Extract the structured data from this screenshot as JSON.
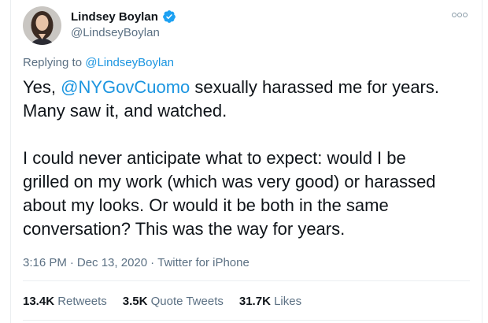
{
  "author": {
    "display_name": "Lindsey Boylan",
    "handle": "@LindseyBoylan",
    "verified_color": "#1da1f2"
  },
  "reply": {
    "prefix": "Replying to",
    "target": "@LindseyBoylan"
  },
  "tweet": {
    "line1_prefix": "Yes, ",
    "mention": "@NYGovCuomo",
    "line1_suffix": " sexually harassed me for years.",
    "line2": "Many saw it, and watched.",
    "paragraph2": "I could never anticipate what to expect: would I be\ngrilled on my work (which was very good) or harassed\nabout my looks. Or would it be both in the same\nconversation? This was the way for years."
  },
  "meta": {
    "time": "3:16 PM",
    "sep1": "·",
    "date": "Dec 13, 2020",
    "sep2": "·",
    "source": "Twitter for iPhone"
  },
  "stats": {
    "retweets_count": "13.4K",
    "retweets_label": "Retweets",
    "quotes_count": "3.5K",
    "quotes_label": "Quote Tweets",
    "likes_count": "31.7K",
    "likes_label": "Likes"
  },
  "colors": {
    "link": "#1b95e0",
    "muted": "#5b7083",
    "text": "#0f1419"
  }
}
